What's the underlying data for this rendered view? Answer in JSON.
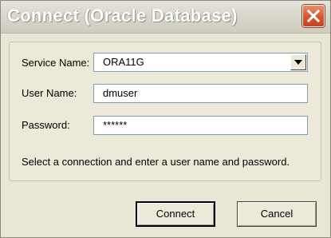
{
  "window": {
    "title": "Connect (Oracle Database)",
    "close_icon": "close-icon"
  },
  "form": {
    "service_name_label": "Service Name:",
    "service_name_value": "ORA11G",
    "user_name_label": "User Name:",
    "user_name_value": "dmuser",
    "password_label": "Password:",
    "password_value": "******",
    "hint": "Select a connection and enter a user name and password."
  },
  "buttons": {
    "connect": "Connect",
    "cancel": "Cancel"
  },
  "colors": {
    "dialog_background": "#ece9d8",
    "close_button": "#d5552f",
    "field_border": "#7f9db9"
  }
}
